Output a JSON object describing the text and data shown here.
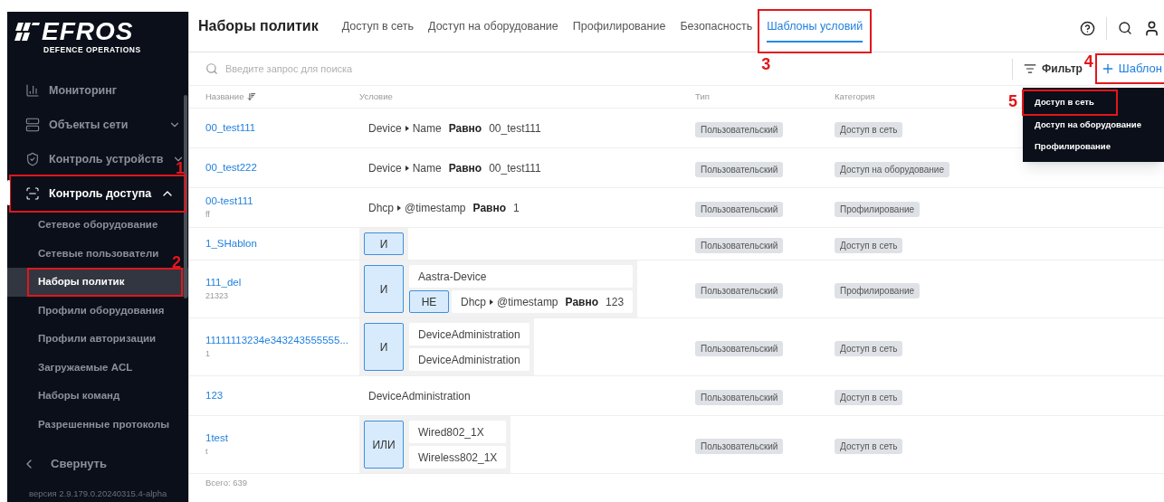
{
  "sidebar": {
    "logo": {
      "name": "EFROS",
      "tagline": "DEFENCE OPERATIONS"
    },
    "items": [
      {
        "label": "Мониторинг",
        "selected": false
      },
      {
        "label": "Объекты сети",
        "expanded": false,
        "selected": false
      },
      {
        "label": "Контроль устройств",
        "expanded": false,
        "selected": false
      },
      {
        "label": "Контроль доступа",
        "expanded": true,
        "selected": true,
        "callout": "1",
        "children": [
          {
            "label": "Сетевое оборудование",
            "selected": false
          },
          {
            "label": "Сетевые пользователи",
            "selected": false
          },
          {
            "label": "Наборы политик",
            "selected": true,
            "callout": "2"
          },
          {
            "label": "Профили оборудования",
            "selected": false
          },
          {
            "label": "Профили авторизации",
            "selected": false
          },
          {
            "label": "Загружаемые ACL",
            "selected": false
          },
          {
            "label": "Наборы команд",
            "selected": false
          },
          {
            "label": "Разрешенные протоколы",
            "selected": false
          }
        ]
      }
    ],
    "collapse": "Свернуть",
    "version": "версия 2.9.179.0.20240315.4-alpha"
  },
  "header": {
    "title": "Наборы политик",
    "tabs": [
      {
        "label": "Доступ в сеть",
        "selected": false
      },
      {
        "label": "Доступ на оборудование",
        "selected": false
      },
      {
        "label": "Профилирование",
        "selected": false
      },
      {
        "label": "Безопасность",
        "selected": false
      },
      {
        "label": "Шаблоны условий",
        "selected": true,
        "callout": "3"
      }
    ]
  },
  "toolbar": {
    "search": {
      "placeholder": "Введите запрос для поиска"
    },
    "filter": "Фильтр",
    "add_button": {
      "label": "Шаблон",
      "callout": "4"
    },
    "menu": [
      {
        "label": "Доступ в сеть",
        "callout": "5"
      },
      {
        "label": "Доступ на оборудование"
      },
      {
        "label": "Профилирование"
      }
    ]
  },
  "table": {
    "columns": [
      "Название",
      "Условие",
      "Тип",
      "Категория"
    ],
    "rows": [
      {
        "name": "00_test111",
        "condition": {
          "kind": "simple",
          "path": [
            "Device",
            "Name"
          ],
          "op": "Равно",
          "value": "00_test111"
        },
        "type": "Пользовательский",
        "category": "Доступ в сеть"
      },
      {
        "name": "00_test222",
        "condition": {
          "kind": "simple",
          "path": [
            "Device",
            "Name"
          ],
          "op": "Равно",
          "value": "00_test111"
        },
        "type": "Пользовательский",
        "category": "Доступ на оборудование"
      },
      {
        "name": "00-test111",
        "description": "ff",
        "condition": {
          "kind": "simple",
          "path": [
            "Dhcp",
            "@timestamp"
          ],
          "op": "Равно",
          "value": "1"
        },
        "type": "Пользовательский",
        "category": "Профилирование"
      },
      {
        "name": "1_SHablon",
        "condition": {
          "kind": "group",
          "operator": "И"
        },
        "type": "Пользовательский",
        "category": "Доступ в сеть"
      },
      {
        "name": "111_del",
        "description": "21323",
        "condition": {
          "kind": "group",
          "operator": "И",
          "children": [
            {
              "kind": "text",
              "text": "Aastra-Device"
            },
            {
              "kind": "not",
              "operator": "НЕ",
              "condition": {
                "kind": "simple",
                "path": [
                  "Dhcp",
                  "@timestamp"
                ],
                "op": "Равно",
                "value": "123"
              }
            }
          ]
        },
        "type": "Пользовательский",
        "category": "Профилирование"
      },
      {
        "name": "11111113234e343243555555...",
        "description": "1",
        "condition": {
          "kind": "group",
          "operator": "И",
          "children": [
            {
              "kind": "text",
              "text": "DeviceAdministration"
            },
            {
              "kind": "text",
              "text": "DeviceAdministration"
            }
          ]
        },
        "type": "Пользовательский",
        "category": "Доступ в сеть"
      },
      {
        "name": "123",
        "condition": {
          "kind": "text",
          "text": "DeviceAdministration"
        },
        "type": "Пользовательский",
        "category": "Доступ в сеть"
      },
      {
        "name": "1test",
        "description": "t",
        "condition": {
          "kind": "group",
          "operator": "ИЛИ",
          "children": [
            {
              "kind": "text",
              "text": "Wired802_1X"
            },
            {
              "kind": "text",
              "text": "Wireless802_1X"
            }
          ]
        },
        "type": "Пользовательский",
        "category": "Доступ в сеть"
      }
    ],
    "total": "Всего: 639"
  }
}
